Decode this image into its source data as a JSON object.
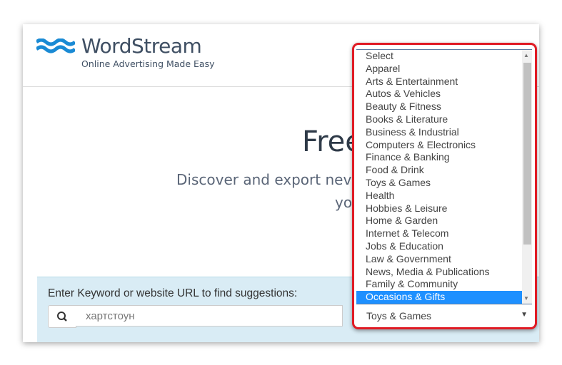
{
  "brand": {
    "name": "WordStream",
    "tagline": "Online Advertising Made Easy",
    "color": "#1a8ad4"
  },
  "hero": {
    "title_partial": "Free",
    "subtitle_line1_partial": "Discover and export nev",
    "subtitle_line2_partial": "yo"
  },
  "search": {
    "label": "Enter Keyword or website URL to find suggestions:",
    "value": "хартстоун",
    "icon": "search-icon"
  },
  "category_dropdown": {
    "options": [
      "Select",
      "Apparel",
      "Arts & Entertainment",
      "Autos & Vehicles",
      "Beauty & Fitness",
      "Books & Literature",
      "Business & Industrial",
      "Computers & Electronics",
      "Finance & Banking",
      "Food & Drink",
      "Toys & Games",
      "Health",
      "Hobbies & Leisure",
      "Home & Garden",
      "Internet & Telecom",
      "Jobs & Education",
      "Law & Government",
      "News, Media & Publications",
      "Family & Community",
      "Occasions & Gifts"
    ],
    "highlighted": "Occasions & Gifts",
    "selected_value": "Toys & Games",
    "highlight_color": "#1e90ff",
    "annotation_color": "#e01b24"
  }
}
